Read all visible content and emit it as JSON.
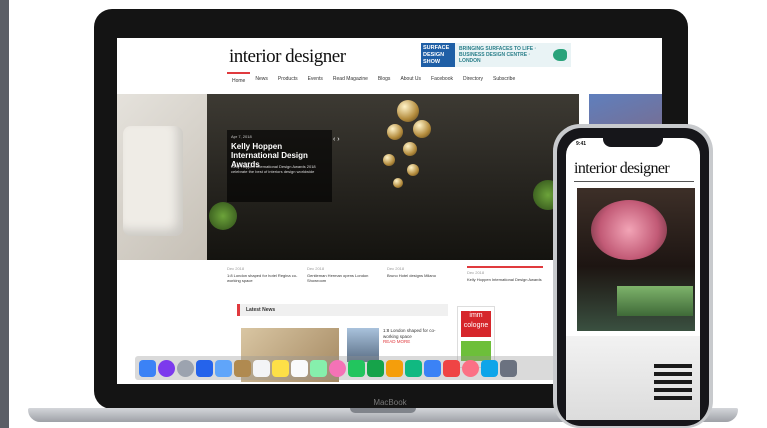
{
  "site": {
    "logo": "interior designer"
  },
  "ad": {
    "brand": "SURFACE DESIGN SHOW",
    "text": "BRINGING SURFACES TO LIFE · BUSINESS DESIGN CENTRE · LONDON"
  },
  "nav": {
    "items": [
      "Home",
      "News",
      "Products",
      "Events",
      "Read Magazine",
      "Blogs",
      "About Us",
      "Facebook",
      "Directory",
      "Subscribe"
    ],
    "active": "Home"
  },
  "hero": {
    "date": "Apr 7, 2018",
    "title": "Kelly Hoppen International Design Awards",
    "body": "Kelly Hoppen International Design Awards 2018 celebrate the best of interiors design worldwide",
    "prev": "‹",
    "next": "›"
  },
  "thumbs": [
    {
      "date": "Dec 2018",
      "title": "1:8 London shaped for hotel Regina co-working space"
    },
    {
      "date": "Dec 2018",
      "title": "Gentleman Herman opens London Showroom"
    },
    {
      "date": "Dec 2018",
      "title": "Bruno Hotel designs Milano"
    },
    {
      "date": "Dec 2018",
      "title": "Kelly Hoppen International Design Awards"
    }
  ],
  "latest": {
    "heading": "Latest News",
    "story": "1:8 London shaped for co-working space",
    "more": "READ MORE"
  },
  "side_ad": {
    "label": "imm cologne"
  },
  "laptop": {
    "label": "MacBook"
  },
  "phone": {
    "time": "9:41",
    "logo": "interior designer"
  },
  "dock": {
    "icons": [
      "finder-icon",
      "siri-icon",
      "launchpad-icon",
      "safari-icon",
      "mail-icon",
      "contacts-icon",
      "calendar-icon",
      "notes-icon",
      "reminders-icon",
      "maps-icon",
      "photos-icon",
      "messages-icon",
      "facetime-icon",
      "pages-icon",
      "numbers-icon",
      "keynote-icon",
      "news-icon",
      "music-icon",
      "appstore-icon",
      "settings-icon"
    ],
    "colors": [
      "#3b82f6",
      "#7c3aed",
      "#9ca3af",
      "#2563eb",
      "#60a5fa",
      "#b08a50",
      "#f3f4f6",
      "#fde047",
      "#f9fafb",
      "#86efac",
      "#f472b6",
      "#22c55e",
      "#16a34a",
      "#f59e0b",
      "#10b981",
      "#3b82f6",
      "#ef4444",
      "#fb7185",
      "#0ea5e9",
      "#6b7280"
    ]
  }
}
